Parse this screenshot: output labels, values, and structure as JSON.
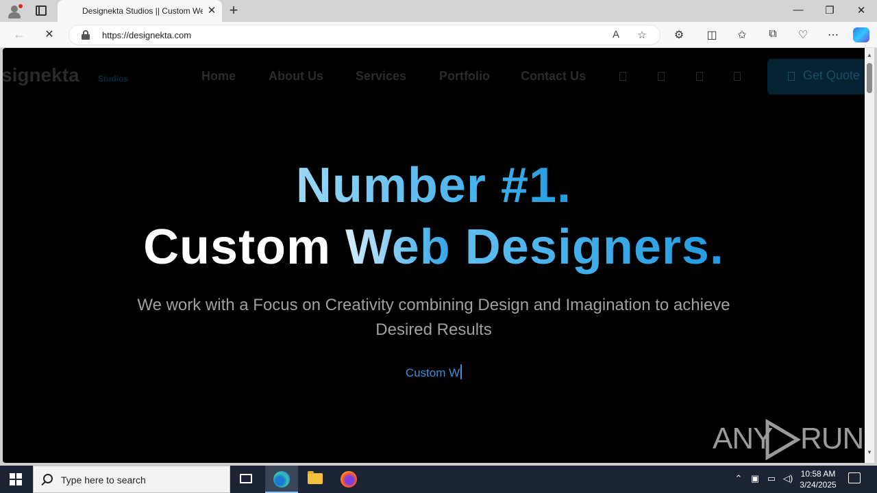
{
  "browser": {
    "tab_title": "Designekta Studios || Custom Web Design",
    "tab_close": "✕",
    "new_tab": "+",
    "url": "https://designekta.com",
    "window_buttons": {
      "minimize": "—",
      "restore": "❐",
      "close": "✕"
    },
    "nav": {
      "back": "←",
      "reload": "✕"
    }
  },
  "site": {
    "logo_text": "signekta",
    "logo_sub": "Studios",
    "nav_links": [
      "Home",
      "About Us",
      "Services",
      "Portfolio",
      "Contact Us"
    ],
    "cta_label": "Get Quote",
    "hero": {
      "line1": "Number #1.",
      "line2_word1": "Custom",
      "line2_word2": "Web",
      "line2_word3": "Designers.",
      "subtitle": "We work with a Focus on Creativity combining Design and Imagination to achieve Desired Results",
      "typed_text": "Custom W"
    },
    "colors": {
      "accent": "#1f9be0",
      "background": "#000000"
    }
  },
  "watermark": {
    "left": "ANY",
    "right": "RUN"
  },
  "taskbar": {
    "search_placeholder": "Type here to search",
    "time": "10:58 AM",
    "date": "3/24/2025"
  }
}
